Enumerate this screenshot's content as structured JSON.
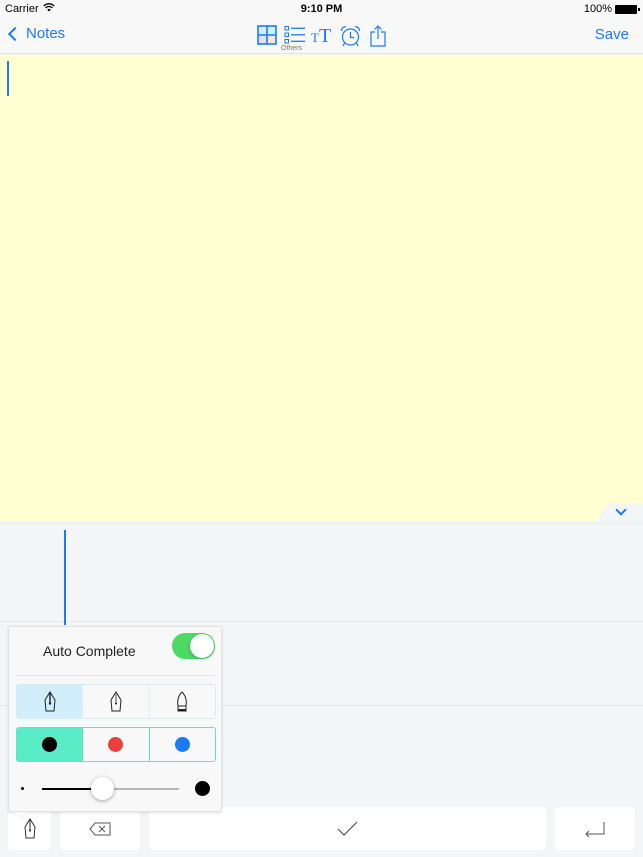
{
  "status_bar": {
    "carrier": "Carrier",
    "wifi_icon": "wifi-icon",
    "time": "9:10 PM",
    "battery_percent": "100%",
    "battery_level": 1.0
  },
  "nav": {
    "back_label": "Notes",
    "save_label": "Save",
    "tools": [
      {
        "name": "color-grid-icon"
      },
      {
        "name": "list-icon",
        "caption": "Others"
      },
      {
        "name": "text-size-icon",
        "glyph_small": "T",
        "glyph_large": "T"
      },
      {
        "name": "alarm-clock-icon"
      },
      {
        "name": "share-icon"
      }
    ]
  },
  "note": {
    "text": "",
    "background": "#ffffd1",
    "cursor_color": "#1a7cf5"
  },
  "handwriting_panel": {
    "collapse_icon": "chevron-down-icon"
  },
  "popover": {
    "auto_complete_label": "Auto Complete",
    "auto_complete_on": true,
    "pen_styles": [
      {
        "name": "fountain-pen-filled",
        "selected": true
      },
      {
        "name": "fountain-pen-outline",
        "selected": false
      },
      {
        "name": "brush-pen",
        "selected": false
      }
    ],
    "colors": [
      {
        "name": "black",
        "hex": "#000000",
        "selected": true
      },
      {
        "name": "red",
        "hex": "#e8403a",
        "selected": false
      },
      {
        "name": "blue",
        "hex": "#1a7cf5",
        "selected": false
      }
    ],
    "stroke_width_fraction": 0.44
  },
  "keys": [
    {
      "name": "pen-settings-key",
      "icon": "pen-nib-icon"
    },
    {
      "name": "backspace-key",
      "icon": "backspace-icon"
    },
    {
      "name": "confirm-key",
      "icon": "checkmark-icon"
    },
    {
      "name": "return-key",
      "icon": "return-icon"
    }
  ],
  "colors": {
    "accent": "#1a7cf5",
    "toggle_on": "#4cd964",
    "color_segment_selected": "#5aecc6",
    "pen_segment_selected": "#d2edfb"
  }
}
